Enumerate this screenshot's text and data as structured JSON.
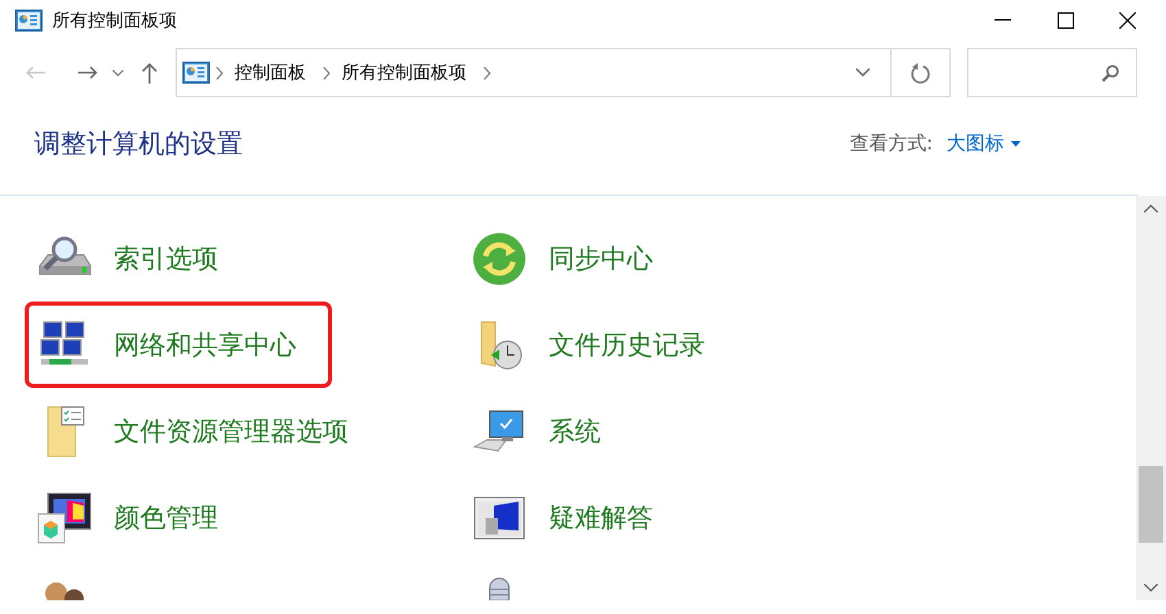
{
  "window": {
    "title": "所有控制面板项"
  },
  "address_bar": {
    "breadcrumbs": [
      "控制面板",
      "所有控制面板项"
    ]
  },
  "heading": "调整计算机的设置",
  "view_by": {
    "label": "查看方式:",
    "value": "大图标"
  },
  "items": [
    {
      "label": "索引选项",
      "kind": "indexing",
      "highlighted": false
    },
    {
      "label": "同步中心",
      "kind": "sync",
      "highlighted": false
    },
    {
      "label": "网络和共享中心",
      "kind": "network",
      "highlighted": true
    },
    {
      "label": "文件历史记录",
      "kind": "history",
      "highlighted": false
    },
    {
      "label": "文件资源管理器选项",
      "kind": "folder",
      "highlighted": false
    },
    {
      "label": "系统",
      "kind": "system",
      "highlighted": false
    },
    {
      "label": "颜色管理",
      "kind": "color",
      "highlighted": false
    },
    {
      "label": "疑难解答",
      "kind": "troubleshoot",
      "highlighted": false
    },
    {
      "kind": "users",
      "highlighted": false
    },
    {
      "kind": "speech",
      "highlighted": false
    }
  ]
}
